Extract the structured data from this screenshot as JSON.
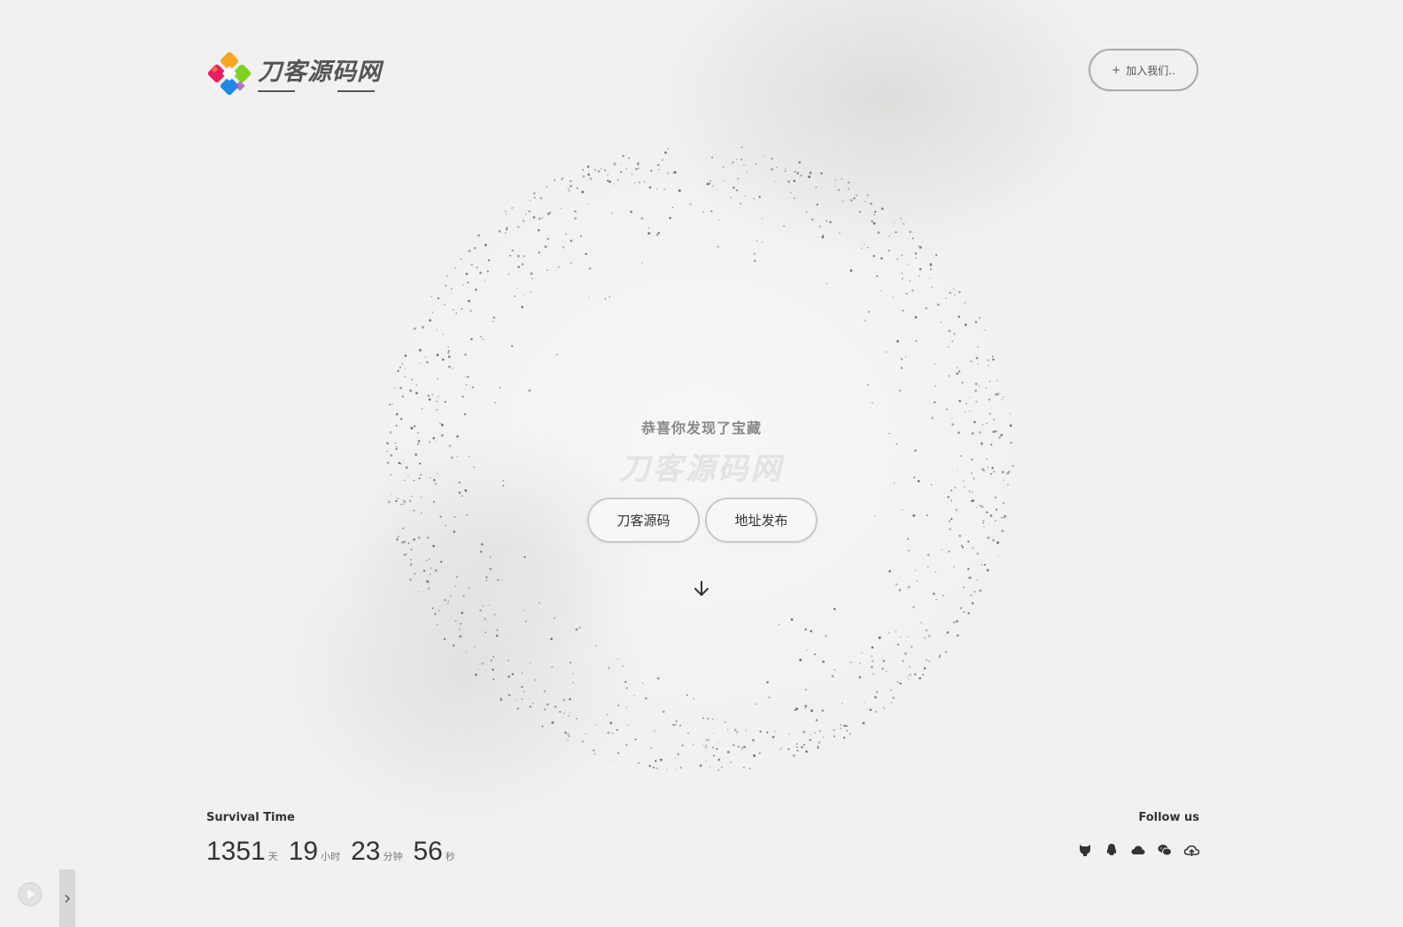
{
  "brand": {
    "name": "刀客源码网",
    "logo_colors": [
      "#f5a623",
      "#7ed321",
      "#4a90e2",
      "#e91e63",
      "#9b59b6"
    ]
  },
  "header": {
    "join_label": "加入我们..",
    "join_icon": "plus-icon"
  },
  "hero": {
    "tagline": "恭喜你发现了宝藏",
    "ghost_title": "刀客源码网",
    "buttons": [
      {
        "label": "刀客源码"
      },
      {
        "label": "地址发布"
      }
    ],
    "scroll_icon": "arrow-down-icon"
  },
  "survival": {
    "title": "Survival Time",
    "days": "1351",
    "days_unit": "天",
    "hours": "19",
    "hours_unit": "小时",
    "minutes": "23",
    "minutes_unit": "分钟",
    "seconds": "56",
    "seconds_unit": "秒"
  },
  "follow": {
    "title": "Follow us",
    "icons": [
      "github-icon",
      "qq-icon",
      "cloud-icon",
      "wechat-icon",
      "cloud-upload-icon"
    ]
  },
  "player": {
    "play_icon": "play-icon",
    "expand_icon": "chevron-right-icon"
  },
  "colors": {
    "background": "#f2f2f2",
    "text": "#333333",
    "dot": "#555555"
  }
}
